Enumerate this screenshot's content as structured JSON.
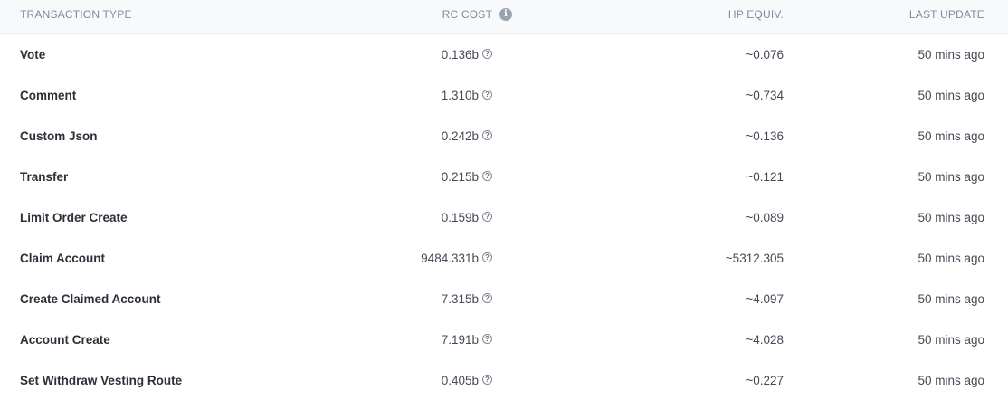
{
  "header": {
    "transaction_type": "TRANSACTION TYPE",
    "rc_cost": "RC COST",
    "rc_info_glyph": "i",
    "hp_equiv": "HP EQUIV.",
    "last_update": "LAST UPDATE"
  },
  "help_glyph": "?",
  "rows": [
    {
      "type": "Vote",
      "rc_cost": "0.136b",
      "hp_equiv": "~0.076",
      "last_update": "50 mins ago"
    },
    {
      "type": "Comment",
      "rc_cost": "1.310b",
      "hp_equiv": "~0.734",
      "last_update": "50 mins ago"
    },
    {
      "type": "Custom Json",
      "rc_cost": "0.242b",
      "hp_equiv": "~0.136",
      "last_update": "50 mins ago"
    },
    {
      "type": "Transfer",
      "rc_cost": "0.215b",
      "hp_equiv": "~0.121",
      "last_update": "50 mins ago"
    },
    {
      "type": "Limit Order Create",
      "rc_cost": "0.159b",
      "hp_equiv": "~0.089",
      "last_update": "50 mins ago"
    },
    {
      "type": "Claim Account",
      "rc_cost": "9484.331b",
      "hp_equiv": "~5312.305",
      "last_update": "50 mins ago"
    },
    {
      "type": "Create Claimed Account",
      "rc_cost": "7.315b",
      "hp_equiv": "~4.097",
      "last_update": "50 mins ago"
    },
    {
      "type": "Account Create",
      "rc_cost": "7.191b",
      "hp_equiv": "~4.028",
      "last_update": "50 mins ago"
    },
    {
      "type": "Set Withdraw Vesting Route",
      "rc_cost": "0.405b",
      "hp_equiv": "~0.227",
      "last_update": "50 mins ago"
    }
  ]
}
